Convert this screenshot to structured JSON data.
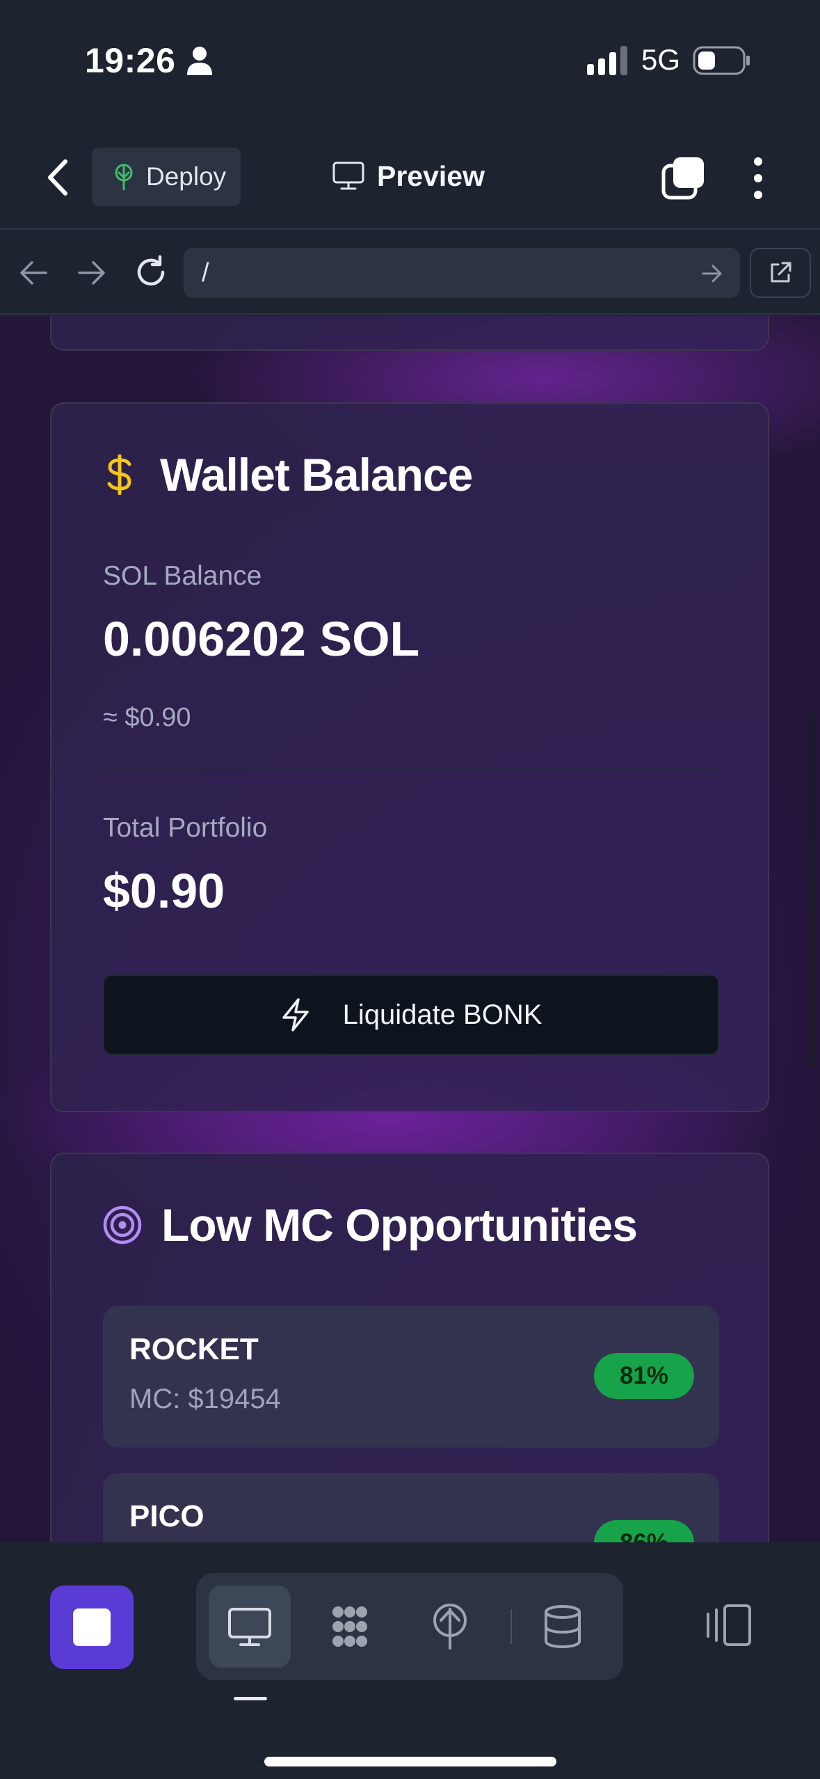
{
  "status_bar": {
    "time": "19:26",
    "network": "5G",
    "icons": [
      "person-icon",
      "signal-icon",
      "battery-icon"
    ]
  },
  "top_nav": {
    "deploy_label": "Deploy",
    "preview_label": "Preview",
    "icons": [
      "back-icon",
      "tree-icon",
      "monitor-icon",
      "tabs-icon",
      "more-icon"
    ]
  },
  "url_bar": {
    "url": "/",
    "icons": [
      "nav-back-icon",
      "nav-forward-icon",
      "reload-icon",
      "url-go-icon",
      "open-external-icon"
    ]
  },
  "wallet": {
    "title": "Wallet Balance",
    "sol_label": "SOL Balance",
    "sol_value": "0.006202 SOL",
    "sol_usd": "≈ $0.90",
    "portfolio_label": "Total Portfolio",
    "portfolio_value": "$0.90",
    "liquidate_label": "Liquidate BONK"
  },
  "opportunities": {
    "title": "Low MC Opportunities",
    "items": [
      {
        "symbol": "ROCKET",
        "mc": "MC: $19454",
        "score": "81%"
      },
      {
        "symbol": "PICO",
        "mc": "",
        "score": "86%"
      }
    ]
  },
  "bottom_bar": {
    "tools": [
      "preview",
      "workspace",
      "deploy",
      "database"
    ],
    "active_tool": "preview"
  },
  "colors": {
    "accent_purple": "#5b3bd6",
    "score_green": "#17a34a",
    "dollar_yellow": "#f5c518",
    "target_purple": "#b58cf5",
    "deploy_green": "#3fbf6a"
  }
}
